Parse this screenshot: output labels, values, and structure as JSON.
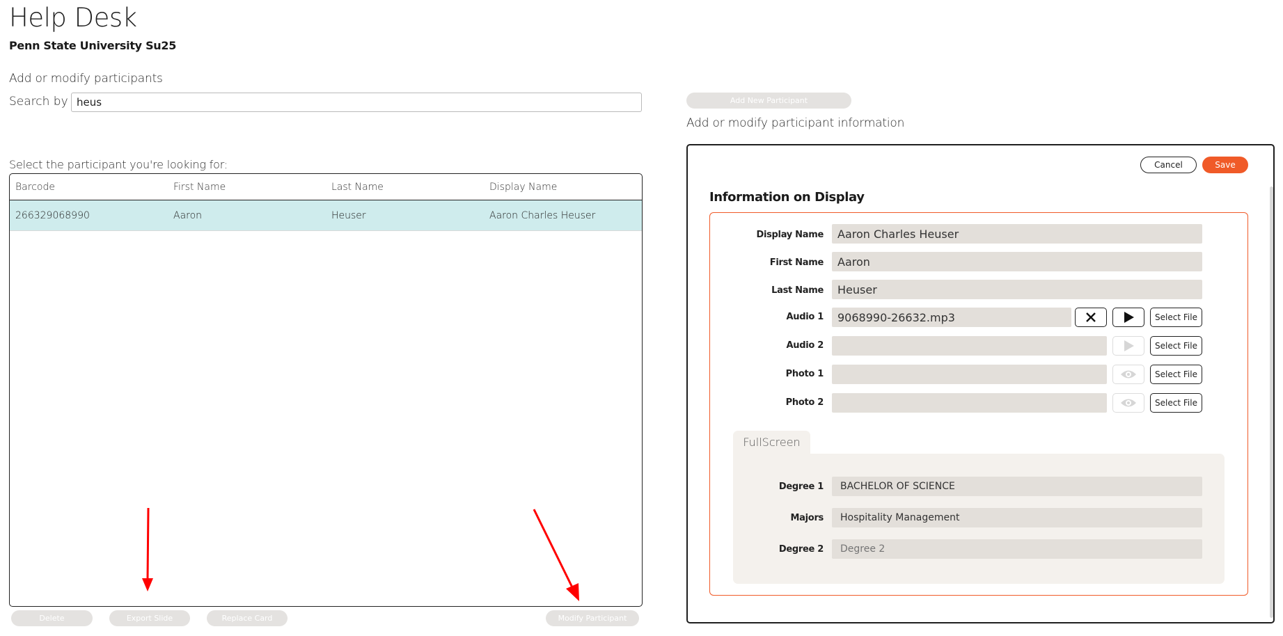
{
  "header": {
    "title": "Help Desk",
    "subtitle": "Penn State University Su25"
  },
  "left": {
    "section_label": "Add or modify participants",
    "search_label": "Search by",
    "search_value": "heus",
    "select_label": "Select the participant you're looking for:",
    "columns": [
      "Barcode",
      "First Name",
      "Last Name",
      "Display Name"
    ],
    "rows": [
      {
        "barcode": "266329068990",
        "first": "Aaron",
        "last": "Heuser",
        "display": "Aaron Charles Heuser"
      }
    ],
    "buttons": {
      "delete": "Delete",
      "export": "Export Slide",
      "replace": "Replace Card",
      "modify": "Modify Participant"
    }
  },
  "right": {
    "add_new_label": "Add New Participant",
    "section_label": "Add or modify participant information",
    "cancel_label": "Cancel",
    "save_label": "Save",
    "info_title": "Information on Display",
    "fields": {
      "display_name_label": "Display Name",
      "display_name_value": "Aaron Charles Heuser",
      "first_name_label": "First Name",
      "first_name_value": "Aaron",
      "last_name_label": "Last Name",
      "last_name_value": "Heuser",
      "audio1_label": "Audio 1",
      "audio1_value": "9068990-26632.mp3",
      "audio2_label": "Audio 2",
      "audio2_value": "",
      "photo1_label": "Photo 1",
      "photo1_value": "",
      "photo2_label": "Photo 2",
      "photo2_value": "",
      "select_file_label": "Select File"
    },
    "tab_label": "FullScreen",
    "fullscreen": {
      "degree1_label": "Degree 1",
      "degree1_value": "BACHELOR OF SCIENCE",
      "majors_label": "Majors",
      "majors_value": "Hospitality Management",
      "degree2_label": "Degree 2",
      "degree2_placeholder": "Degree 2"
    }
  },
  "colors": {
    "accent": "#f05a28",
    "row_highlight": "#cfeced",
    "field_bg": "#e3dfda",
    "annotation_arrow": "#ff0000"
  }
}
